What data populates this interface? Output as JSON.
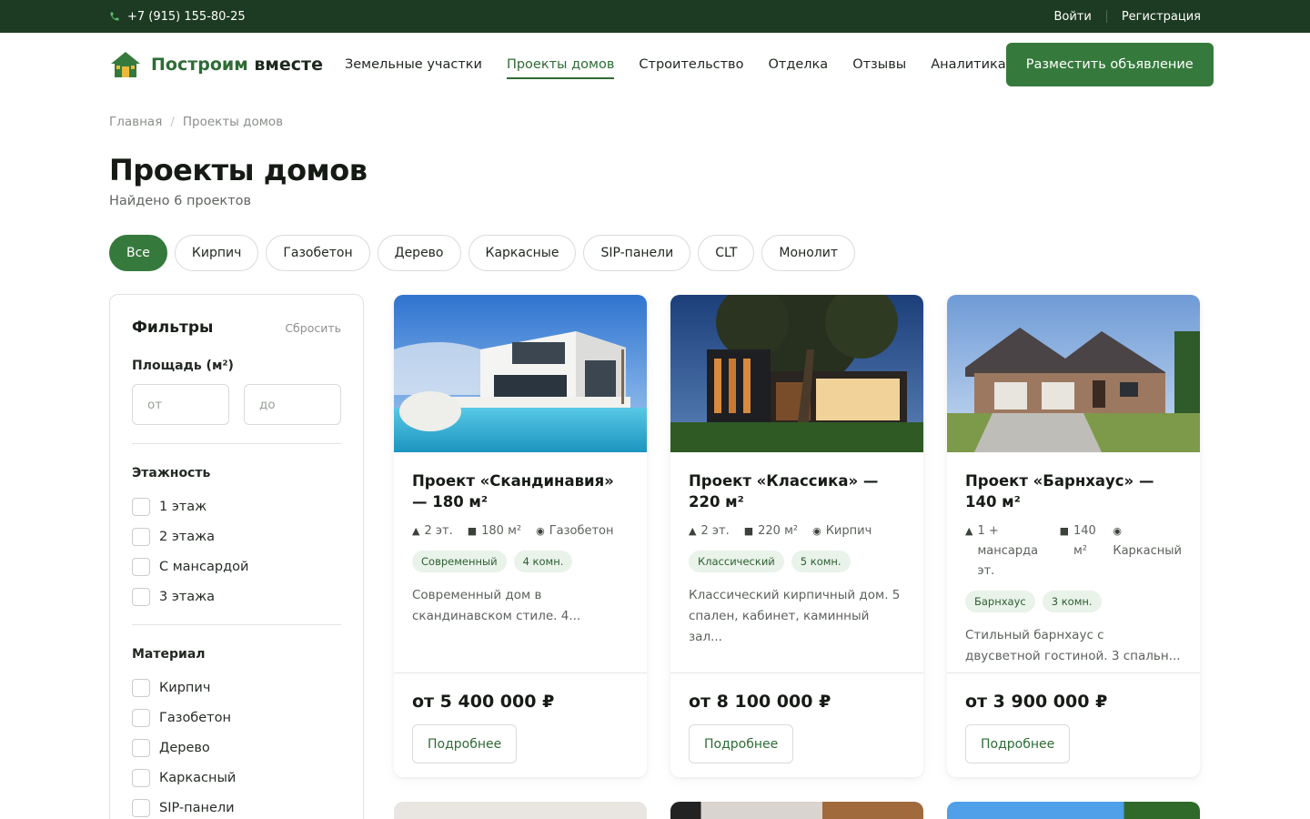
{
  "topbar": {
    "phone": "+7 (915) 155-80-25",
    "login": "Войти",
    "register": "Регистрация"
  },
  "header": {
    "logo_main": "Построим",
    "logo_accent": "вместе",
    "nav": [
      "Земельные участки",
      "Проекты домов",
      "Строительство",
      "Отделка",
      "Отзывы",
      "Аналитика"
    ],
    "active_nav": "Проекты домов",
    "cta": "Разместить объявление"
  },
  "breadcrumb": {
    "home": "Главная",
    "current": "Проекты домов"
  },
  "page": {
    "title": "Проекты домов",
    "subtitle": "Найдено 6 проектов"
  },
  "chips": [
    "Все",
    "Кирпич",
    "Газобетон",
    "Дерево",
    "Каркасные",
    "SIP-панели",
    "CLT",
    "Монолит"
  ],
  "filters": {
    "title": "Фильтры",
    "reset": "Сбросить",
    "area_label": "Площадь (м²)",
    "area_from_placeholder": "от",
    "area_to_placeholder": "до",
    "floors_label": "Этажность",
    "floors": [
      "1 этаж",
      "2 этажа",
      "С мансардой",
      "3 этажа"
    ],
    "material_label": "Материал",
    "materials": [
      "Кирпич",
      "Газобетон",
      "Дерево",
      "Каркасный",
      "SIP-панели"
    ]
  },
  "cards": [
    {
      "title": "Проект «Скандинавия» — 180 м²",
      "floors": "2 эт.",
      "area": "180 м²",
      "material": "Газобетон",
      "tags": [
        "Современный",
        "4 комн."
      ],
      "desc": "Современный дом в скандинавском стиле. 4...",
      "price": "от 5 400 000 ₽",
      "button": "Подробнее"
    },
    {
      "title": "Проект «Классика» — 220 м²",
      "floors": "2 эт.",
      "area": "220 м²",
      "material": "Кирпич",
      "tags": [
        "Классический",
        "5 комн."
      ],
      "desc": "Классический кирпичный дом. 5 спален, кабинет, каминный зал...",
      "price": "от 8 100 000 ₽",
      "button": "Подробнее"
    },
    {
      "title": "Проект «Барнхаус» — 140 м²",
      "floors": "1 + мансарда эт.",
      "area": "140 м²",
      "material": "Каркасный",
      "tags": [
        "Барнхаус",
        "3 комн."
      ],
      "desc": "Стильный барнхаус с двусветной гостиной. 3 спальн...",
      "price": "от 3 900 000 ₽",
      "button": "Подробнее"
    }
  ],
  "colors": {
    "brand": "#357a3c",
    "topbar": "#1d3b22",
    "tag_bg": "#e9f3ea"
  }
}
